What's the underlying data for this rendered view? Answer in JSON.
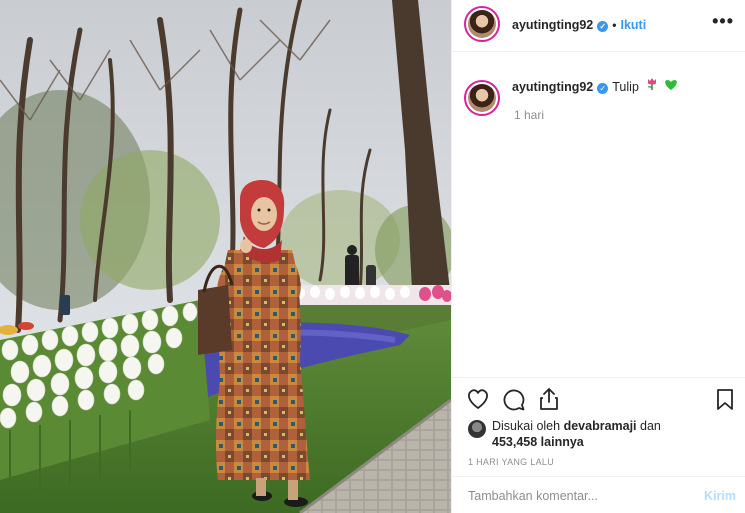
{
  "post": {
    "username": "ayutingting92",
    "verified_icon": "verified-badge-icon",
    "separator": "•",
    "follow_label": "Ikuti",
    "more_label": "•••",
    "caption": {
      "username": "ayutingting92",
      "text": "Tulip",
      "emoji": [
        "tulip-icon",
        "green-heart-icon"
      ],
      "time": "1 hari"
    },
    "likes": {
      "prefix": "Disukai oleh",
      "user": "devabramaji",
      "conjunction": "dan",
      "count": "453,458",
      "suffix": "lainnya"
    },
    "timestamp": "1 HARI YANG LALU",
    "comment": {
      "placeholder": "Tambahkan komentar...",
      "send_label": "Kirim"
    }
  },
  "colors": {
    "accent": "#3897f0",
    "send_disabled": "#b2dffc",
    "muted": "#8e8e8e",
    "divider": "#efefef"
  }
}
